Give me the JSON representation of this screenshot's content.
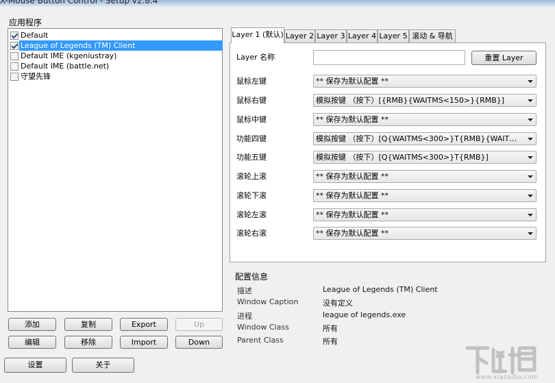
{
  "window": {
    "title": "X-Mouse Button Control - Setup v2.8.4"
  },
  "apps": {
    "label": "应用程序",
    "items": [
      {
        "label": "Default",
        "checked": true,
        "selected": false
      },
      {
        "label": "League of Legends (TM) Client",
        "checked": true,
        "selected": true
      },
      {
        "label": "Default IME (kgeniustray)",
        "checked": false,
        "selected": false
      },
      {
        "label": "Default IME (battle.net)",
        "checked": false,
        "selected": false
      },
      {
        "label": "守望先锋",
        "checked": false,
        "selected": false
      }
    ]
  },
  "app_buttons": {
    "add": "添加",
    "copy": "复制",
    "export": "Export",
    "up": "Up",
    "edit": "编辑",
    "move": "移除",
    "import": "Import",
    "down": "Down"
  },
  "tabs": [
    "Layer 1 (默认)",
    "Layer 2",
    "Layer 3",
    "Layer 4",
    "Layer 5",
    "滚动 & 导航"
  ],
  "layer": {
    "name_label": "Layer 名称",
    "name_value": "",
    "reset_button": "重置 Layer"
  },
  "mappings": [
    {
      "label": "鼠标左键",
      "value": "** 保存为默认配置 **"
    },
    {
      "label": "鼠标右键",
      "value": "模拟按键 （按下）[{RMB}{WAITMS<150>}{RMB}]"
    },
    {
      "label": "鼠标中键",
      "value": "** 保存为默认配置 **"
    },
    {
      "label": "功能四键",
      "value": "模拟按键 （按下）[Q{WAITMS<300>}T{RMB}{WAITMS<350..."
    },
    {
      "label": "功能五键",
      "value": "模拟按键 （按下）[Q{WAITMS<300>}T{RMB}]"
    },
    {
      "label": "滚轮上滚",
      "value": "** 保存为默认配置 **"
    },
    {
      "label": "滚轮下滚",
      "value": "** 保存为默认配置 **"
    },
    {
      "label": "滚轮左滚",
      "value": "** 保存为默认配置 **"
    },
    {
      "label": "滚轮右滚",
      "value": "** 保存为默认配置 **"
    }
  ],
  "config_info": {
    "title": "配置信息",
    "rows": [
      {
        "key": "描述",
        "value": "League of Legends (TM) Client"
      },
      {
        "key": "Window Caption",
        "value": "没有定义"
      },
      {
        "key": "进程",
        "value": "league of legends.exe"
      },
      {
        "key": "Window Class",
        "value": "所有"
      },
      {
        "key": "Parent Class",
        "value": "所有"
      }
    ]
  },
  "bottom_buttons": {
    "settings": "设置",
    "about": "关于"
  },
  "watermark": {
    "logo": "下载吧",
    "url": "www.xiazaiba.com"
  }
}
